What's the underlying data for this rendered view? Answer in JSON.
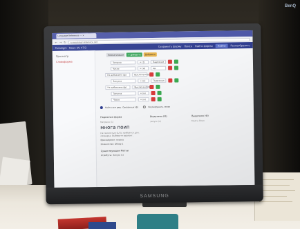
{
  "monitor": {
    "brand": "SAMSUNG",
    "corner_badge": "BenQ"
  },
  "browser": {
    "tab_title": "Language Reference — ×",
    "url": "ru-grammar-reference.dict",
    "nav_glyphs": [
      "←",
      "→",
      "↻"
    ]
  },
  "appbar": {
    "title": "Paradigm · Noun (A) 47/2",
    "items": [
      "Сохранить форму",
      "Поиск",
      "Найти формы"
    ],
    "pill": "Найти",
    "last": "Разнообразить"
  },
  "sidebar": {
    "items": [
      {
        "label": "Просмотр",
        "active": false
      },
      {
        "label": "Словоформа",
        "active": true
      }
    ]
  },
  "filters": {
    "pills": [
      "Лемматизация",
      "+ Добавить",
      "Добавить"
    ],
    "rows": [
      {
        "label": "Запуска",
        "op": "= (1)",
        "value": "Падежная",
        "indent": 1
      },
      {
        "label": "Число",
        "op": "= (м)",
        "value": "ед.",
        "indent": 1
      },
      {
        "label": "Не добавлено (ф)",
        "op": "",
        "value": "Выключено (ф)",
        "indent": 0
      },
      {
        "label": "Запуска",
        "op": "= (м)",
        "value": "Падежная",
        "indent": 1
      },
      {
        "label": "Не добавлено (ф)",
        "op": "",
        "value": "Выключено (ф)",
        "indent": 0
      },
      {
        "label": "Запуска",
        "op": "= (м)",
        "value": "",
        "indent": 1
      },
      {
        "label": "Число",
        "op": "= (м)",
        "value": "",
        "indent": 1
      }
    ],
    "radio": [
      {
        "label": "Найти все реш. Связанных (ф)",
        "on": true
      },
      {
        "label": "Не разрушать связи",
        "on": false
      }
    ]
  },
  "result": {
    "columns": [
      "Падежная форма",
      "Выделено (Ф)",
      "Выделено (Ф)"
    ],
    "sub": "Метрика (1)",
    "entry": "многа поип",
    "col2_value": "запуск (п)",
    "col3_value": "Многа Поип",
    "desc": "Не полностью (1/3), требуется доп. проверка. Выберите вариант.",
    "bullets": [
      "Время/время: поиска",
      "Количество: Обзор 1"
    ],
    "section": "Существующие Метки",
    "section_bullets": [
      "Атрибуты: Запуск (с)"
    ]
  }
}
